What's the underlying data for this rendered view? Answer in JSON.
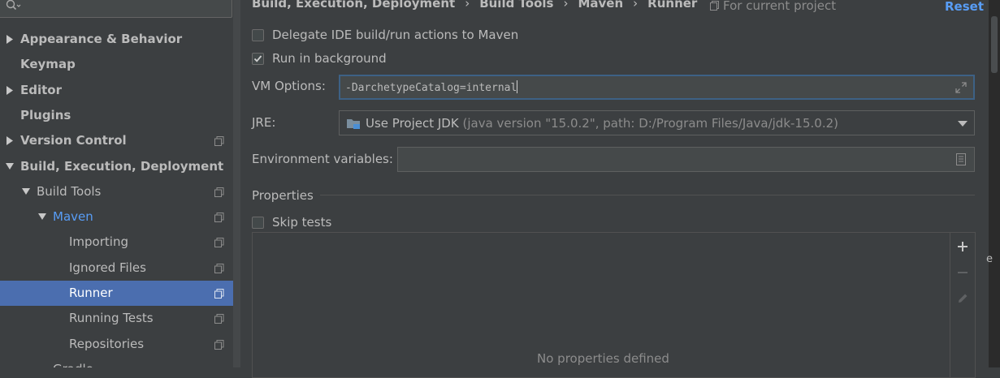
{
  "sidebar": {
    "search_placeholder": "",
    "items": [
      {
        "label": "Appearance & Behavior",
        "level": 0,
        "expand": "collapsed",
        "bold": true,
        "selected": false,
        "copy_icon": false
      },
      {
        "label": "Keymap",
        "level": 0,
        "expand": "none",
        "bold": true,
        "selected": false,
        "copy_icon": false
      },
      {
        "label": "Editor",
        "level": 0,
        "expand": "collapsed",
        "bold": true,
        "selected": false,
        "copy_icon": false
      },
      {
        "label": "Plugins",
        "level": 0,
        "expand": "none",
        "bold": true,
        "selected": false,
        "copy_icon": false
      },
      {
        "label": "Version Control",
        "level": 0,
        "expand": "collapsed",
        "bold": true,
        "selected": false,
        "copy_icon": true
      },
      {
        "label": "Build, Execution, Deployment",
        "level": 0,
        "expand": "expanded",
        "bold": true,
        "selected": false,
        "copy_icon": false
      },
      {
        "label": "Build Tools",
        "level": 1,
        "expand": "expanded",
        "bold": false,
        "selected": false,
        "copy_icon": true
      },
      {
        "label": "Maven",
        "level": 2,
        "expand": "expanded",
        "bold": false,
        "selected": false,
        "copy_icon": true,
        "accent": true
      },
      {
        "label": "Importing",
        "level": 3,
        "expand": "none",
        "bold": false,
        "selected": false,
        "copy_icon": true
      },
      {
        "label": "Ignored Files",
        "level": 3,
        "expand": "none",
        "bold": false,
        "selected": false,
        "copy_icon": true
      },
      {
        "label": "Runner",
        "level": 3,
        "expand": "none",
        "bold": false,
        "selected": true,
        "copy_icon": true
      },
      {
        "label": "Running Tests",
        "level": 3,
        "expand": "none",
        "bold": false,
        "selected": false,
        "copy_icon": true
      },
      {
        "label": "Repositories",
        "level": 3,
        "expand": "none",
        "bold": false,
        "selected": false,
        "copy_icon": true
      },
      {
        "label": "Gradle",
        "level": 2,
        "expand": "none",
        "bold": false,
        "selected": false,
        "copy_icon": false
      }
    ]
  },
  "header": {
    "breadcrumb": [
      "Build, Execution, Deployment",
      "Build Tools",
      "Maven",
      "Runner"
    ],
    "separator": "›",
    "scope": "For current project",
    "reset": "Reset"
  },
  "form": {
    "delegate": {
      "label": "Delegate IDE build/run actions to Maven",
      "checked": false
    },
    "background": {
      "label": "Run in background",
      "checked": true
    },
    "vm_options": {
      "label": "VM Options:",
      "value": "-DarchetypeCatalog=internal"
    },
    "jre": {
      "label": "JRE:",
      "value": "Use Project JDK",
      "detail": "(java version \"15.0.2\", path: D:/Program Files/Java/jdk-15.0.2)"
    },
    "env": {
      "label": "Environment variables:",
      "value": ""
    },
    "properties": {
      "title": "Properties",
      "empty_text": "No properties defined"
    },
    "skip_tests": {
      "label": "Skip tests",
      "checked": false
    }
  },
  "edge": {
    "glyph": "e"
  },
  "colors": {
    "accent": "#589df6",
    "selection": "#4b6eaf",
    "background": "#3c3f41"
  },
  "icons": [
    "search-icon",
    "copy-icon",
    "expand-icon",
    "folder-icon",
    "dropdown-arrow-icon",
    "document-icon",
    "add-icon",
    "remove-icon",
    "edit-icon"
  ]
}
